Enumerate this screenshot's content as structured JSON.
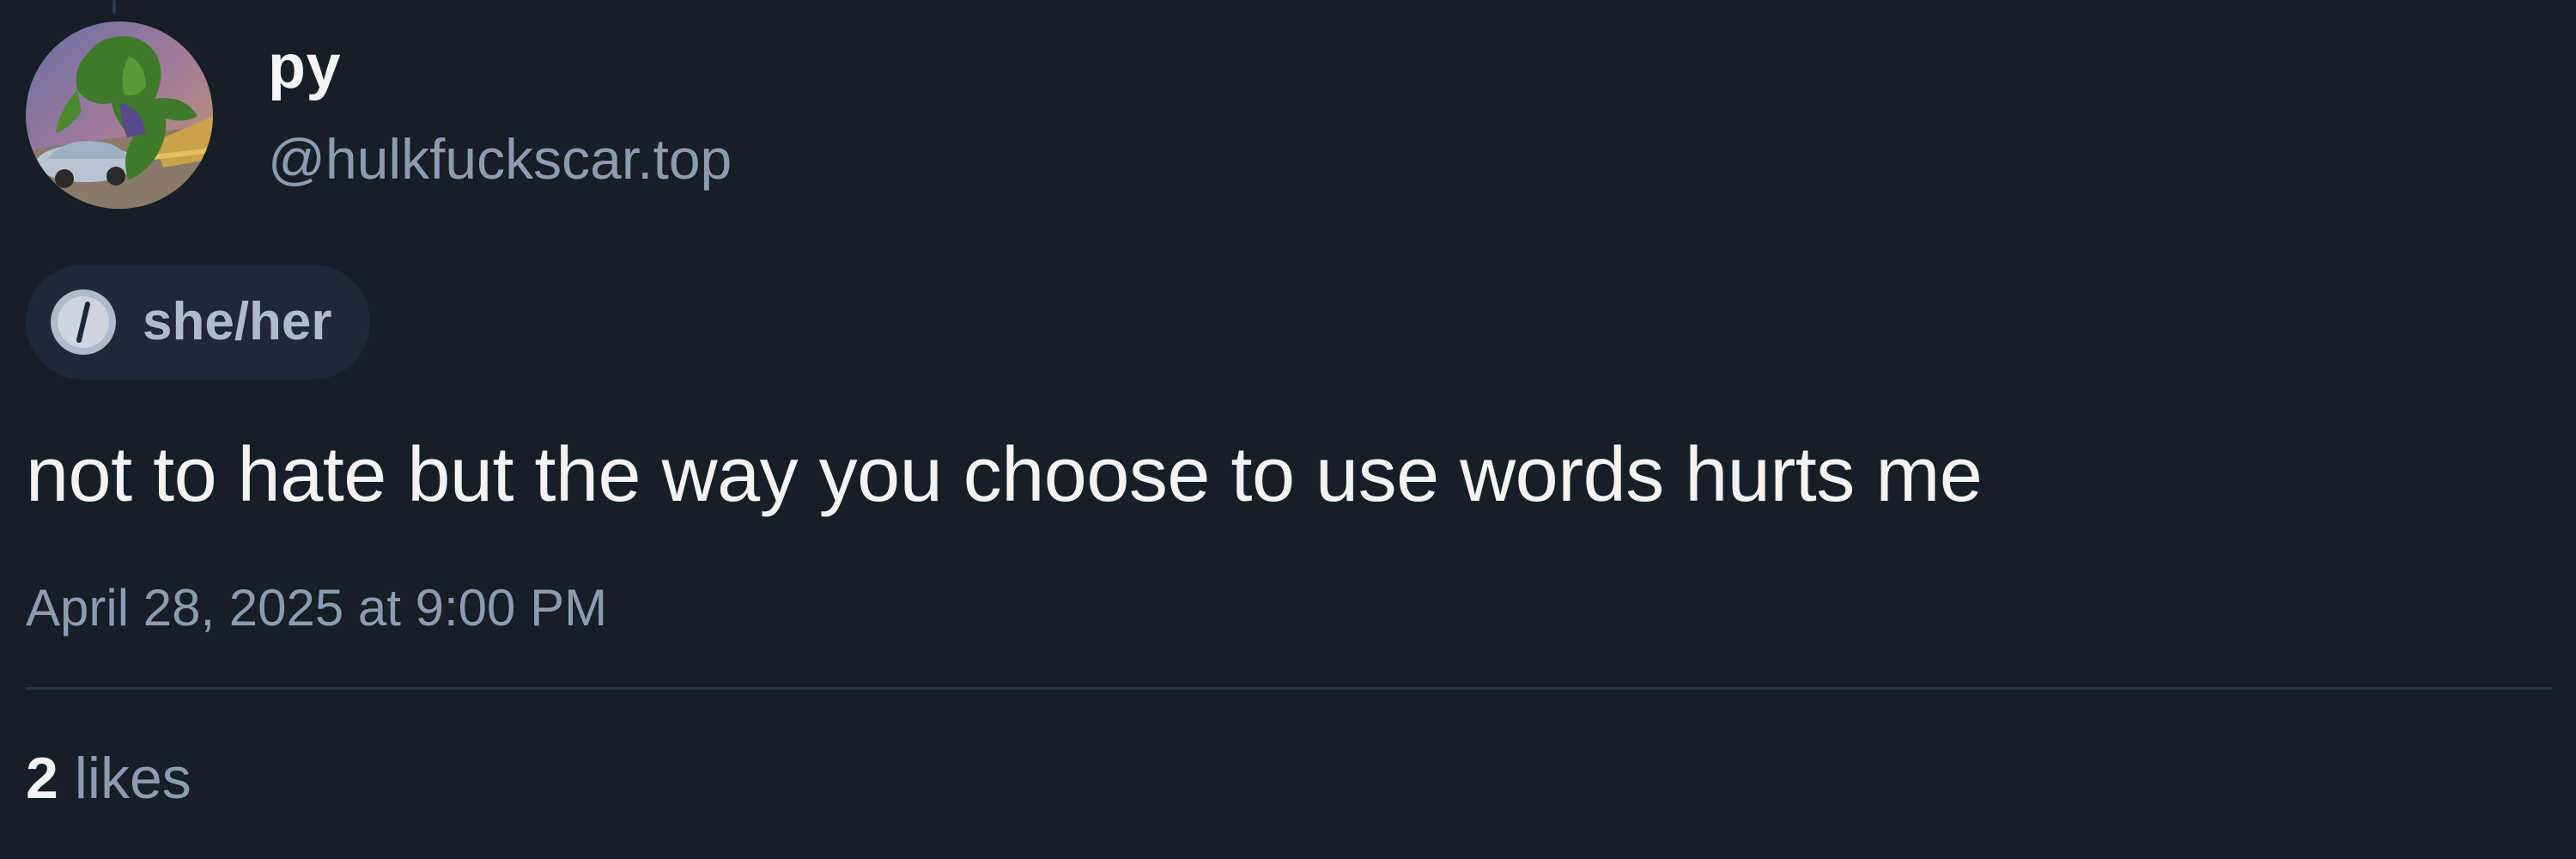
{
  "author": {
    "display_name": "py",
    "handle": "@hulkfuckscar.top",
    "avatar_description": "hulk-and-car-avatar"
  },
  "pronouns": {
    "icon": "info-icon",
    "label": "she/her"
  },
  "post": {
    "text": "not to hate but the way you choose to use words hurts me",
    "timestamp": "April 28, 2025 at 9:00 PM"
  },
  "engagement": {
    "likes_count": "2",
    "likes_label": "likes"
  },
  "colors": {
    "background": "#161e27",
    "primary_text": "#f1f3f5",
    "secondary_text": "#8c9cb0",
    "pill_background": "#1e2937",
    "divider": "#2b3645"
  }
}
